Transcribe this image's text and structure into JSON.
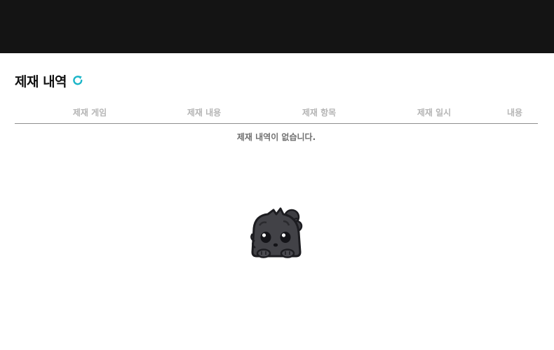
{
  "header": {
    "bar_color": "#141414"
  },
  "section": {
    "title": "제재 내역",
    "refresh_icon": "refresh-icon",
    "accent_color": "#1ab5c8"
  },
  "table": {
    "columns": [
      "제재 게임",
      "제재 내용",
      "제재 항목",
      "제재 일시",
      "내용"
    ],
    "empty_message": "제재 내역이 없습니다."
  },
  "illustration": {
    "icon": "mascot-creature-icon"
  }
}
